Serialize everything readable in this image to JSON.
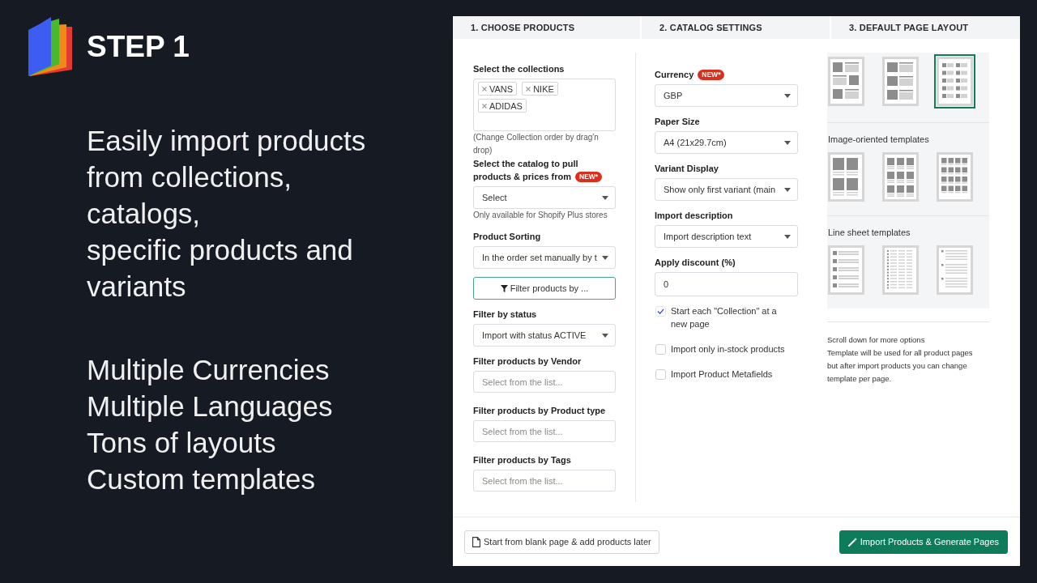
{
  "header": {
    "title": "STEP 1"
  },
  "intro": {
    "lines": [
      "Easily import products",
      "from collections,",
      "catalogs,",
      "specific products and",
      "variants"
    ],
    "features": [
      "Multiple Currencies",
      "Multiple Languages",
      "Tons of layouts",
      "Custom templates"
    ]
  },
  "steps": [
    "1. CHOOSE PRODUCTS",
    "2. CATALOG SETTINGS",
    "3. DEFAULT PAGE LAYOUT"
  ],
  "choose_products": {
    "fields": [
      {
        "kind": "tags",
        "label": "Select the collections",
        "tags": [
          "VANS",
          "NIKE",
          "ADIDAS"
        ],
        "hint": "(Change Collection order by drag'n drop)"
      },
      {
        "kind": "select",
        "label": "Select the catalog to pull products & prices from",
        "badge": "NEW*",
        "value": "Select",
        "hint": "Only available for Shopify Plus stores"
      },
      {
        "kind": "select",
        "label": "Product Sorting",
        "value": "In the order set manually by t"
      },
      {
        "kind": "button",
        "label": "Filter products by ..."
      },
      {
        "kind": "select",
        "label": "Filter by status",
        "value": "Import with status ACTIVE"
      },
      {
        "kind": "input",
        "label": "Filter products by Vendor",
        "placeholder": "Select from the list..."
      },
      {
        "kind": "input",
        "label": "Filter products by Product type",
        "placeholder": "Select from the list..."
      },
      {
        "kind": "input",
        "label": "Filter products by Tags",
        "placeholder": "Select from the list..."
      }
    ]
  },
  "catalog_settings": {
    "fields": [
      {
        "kind": "select",
        "label": "Currency",
        "badge": "NEW*",
        "value": "GBP"
      },
      {
        "kind": "select",
        "label": "Paper Size",
        "value": "A4 (21x29.7cm)"
      },
      {
        "kind": "select",
        "label": "Variant Display",
        "value": "Show only first variant (main"
      },
      {
        "kind": "select",
        "label": "Import description",
        "value": "Import description text"
      },
      {
        "kind": "input",
        "label": "Apply discount (%)",
        "value": "0"
      }
    ],
    "options": [
      {
        "label": "Start each \"Collection\" at a new page",
        "checked": true
      },
      {
        "label": "Import only in-stock products",
        "checked": false
      },
      {
        "label": "Import Product Metafields",
        "checked": false
      }
    ]
  },
  "page_layout": {
    "groups": [
      {
        "templates": [
          {
            "kind": "alternate",
            "selected": false
          },
          {
            "kind": "rows",
            "selected": false
          },
          {
            "kind": "compact",
            "selected": true
          }
        ]
      },
      {
        "title": "Image-oriented templates",
        "templates": [
          {
            "kind": "grid2",
            "selected": false
          },
          {
            "kind": "grid3",
            "selected": false
          },
          {
            "kind": "grid4",
            "selected": false
          }
        ]
      },
      {
        "title": "Line sheet templates",
        "templates": [
          {
            "kind": "lines",
            "selected": false
          },
          {
            "kind": "table",
            "selected": false
          },
          {
            "kind": "sparse",
            "selected": false
          }
        ]
      }
    ],
    "notes": [
      "Scroll down for more options",
      "Template will be used for all product pages but after import products you can change template per page."
    ]
  },
  "footer": {
    "buttons": [
      {
        "kind": "secondary",
        "label": "Start from blank page & add products later"
      },
      {
        "kind": "primary",
        "label": "Import Products & Generate Pages"
      }
    ]
  }
}
